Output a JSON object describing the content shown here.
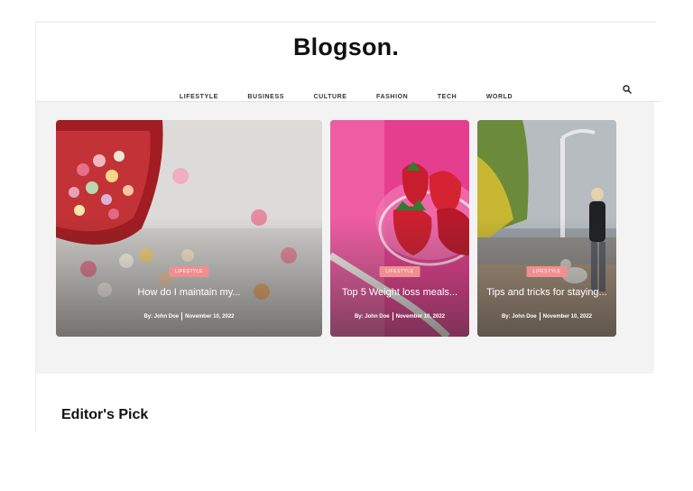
{
  "site": {
    "logo": "Blogson."
  },
  "nav": {
    "items": [
      "LIFESTYLE",
      "BUSINESS",
      "CULTURE",
      "FASHION",
      "TECH",
      "WORLD"
    ]
  },
  "cards": [
    {
      "badge": "LIFESTYLE",
      "title": "How do I maintain my...",
      "author": "By: John Doe",
      "date": "November 10, 2022"
    },
    {
      "badge": "LIFESTYLE",
      "title": "Top 5 Weight loss meals...",
      "author": "By: John Doe",
      "date": "November 10, 2022"
    },
    {
      "badge": "LIFESTYLE",
      "title": "Tips and tricks for staying...",
      "author": "By: John Doe",
      "date": "November 10, 2022"
    }
  ],
  "sections": {
    "editors_pick": "Editor's Pick"
  },
  "icons": {
    "search": "search-icon"
  },
  "colors": {
    "badge": "#f08f90",
    "hero_bg": "#f3f3f3",
    "text": "#111111"
  }
}
